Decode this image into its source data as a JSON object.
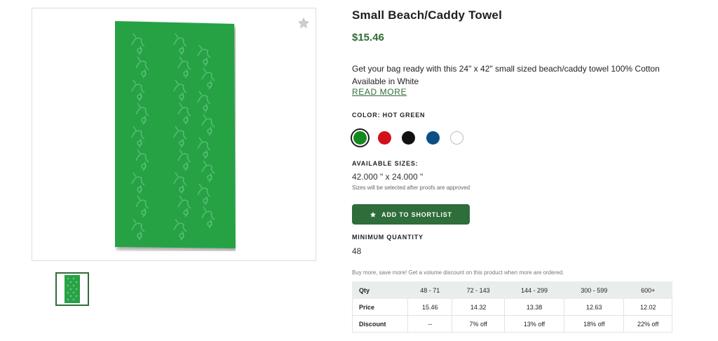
{
  "product": {
    "title": "Small Beach/Caddy Towel",
    "price": "$15.46",
    "description_line1": "Get your bag ready with this 24\" x 42\" small sized beach/caddy towel 100% Cotton",
    "description_line2": "Available in White",
    "read_more": "READ MORE"
  },
  "image": {
    "main_image_icon": "towel-image",
    "favorite_icon": "star-icon",
    "towel_color": "#26a244",
    "pattern_color": "#5cc07a"
  },
  "color": {
    "label": "COLOR: HOT GREEN",
    "swatches": [
      {
        "name": "Hot Green",
        "hex": "#14891f",
        "selected": true
      },
      {
        "name": "Red",
        "hex": "#d3101a",
        "selected": false
      },
      {
        "name": "Black",
        "hex": "#111111",
        "selected": false
      },
      {
        "name": "Navy",
        "hex": "#0b4f86",
        "selected": false
      },
      {
        "name": "White",
        "hex": "#ffffff",
        "selected": false
      }
    ]
  },
  "sizes": {
    "label": "AVAILABLE SIZES:",
    "value": "42.000 \" x 24.000 \"",
    "note": "Sizes will be selected after proofs are approved"
  },
  "shortlist": {
    "label": "ADD TO SHORTLIST",
    "icon": "star-icon"
  },
  "minimum": {
    "label": "MINIMUM QUANTITY",
    "value": "48"
  },
  "volume_note": "Buy more, save more! Get a volume discount on this product when more are ordered.",
  "pricing_table": {
    "header": [
      "Qty",
      "48 - 71",
      "72 - 143",
      "144 - 299",
      "300 - 599",
      "600+"
    ],
    "rows": [
      [
        "Price",
        "15.46",
        "14.32",
        "13.38",
        "12.63",
        "12.02"
      ],
      [
        "Discount",
        "--",
        "7% off",
        "13% off",
        "18% off",
        "22% off"
      ]
    ]
  },
  "colors": {
    "accent": "#2f6d3a",
    "table_header_bg": "#e9eeec"
  }
}
